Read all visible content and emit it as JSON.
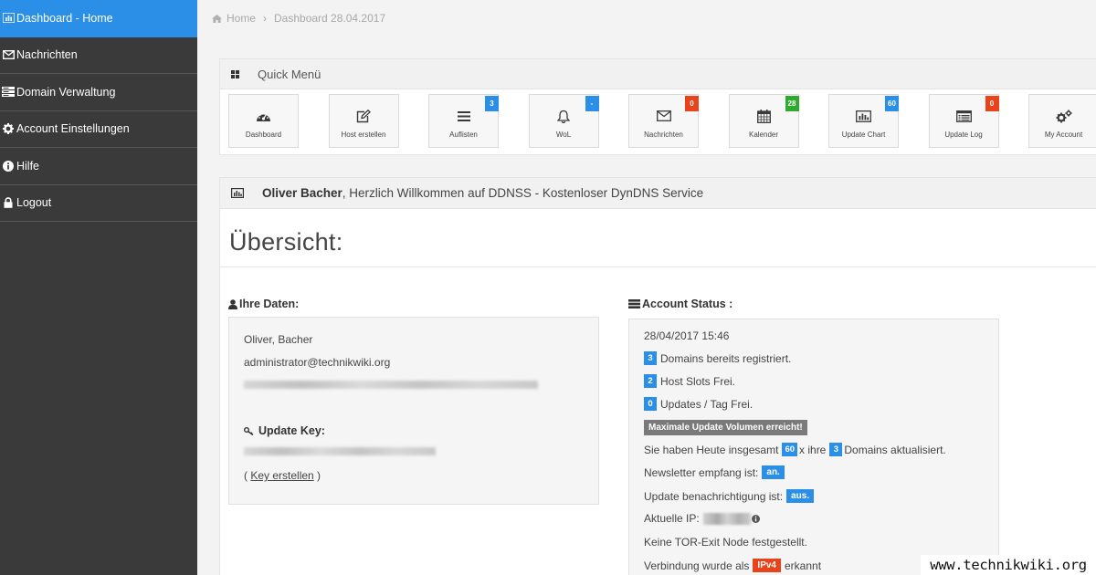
{
  "sidebar": {
    "items": [
      {
        "label": "Dashboard - Home",
        "icon": "bar-chart-icon",
        "active": true
      },
      {
        "label": "Nachrichten",
        "icon": "envelope-icon"
      },
      {
        "label": "Domain Verwaltung",
        "icon": "server-icon"
      },
      {
        "label": "Account Einstellungen",
        "icon": "gear-icon"
      },
      {
        "label": "Hilfe",
        "icon": "info-circle-icon"
      },
      {
        "label": "Logout",
        "icon": "lock-icon"
      }
    ]
  },
  "breadcrumb": {
    "home": "Home",
    "separator": "›",
    "current": "Dashboard 28.04.2017"
  },
  "quick_menu": {
    "title": "Quick Menü",
    "tiles": [
      {
        "label": "Dashboard",
        "icon": "tachometer-icon",
        "badge": null
      },
      {
        "label": "Host erstellen",
        "icon": "edit-icon",
        "badge": null
      },
      {
        "label": "Auflisten",
        "icon": "list-icon",
        "badge": "3",
        "badge_color": "#2b8fe8"
      },
      {
        "label": "WoL",
        "icon": "bell-icon",
        "badge": "-",
        "badge_color": "#2b8fe8"
      },
      {
        "label": "Nachrichten",
        "icon": "envelope-icon",
        "badge": "0",
        "badge_color": "#e8431a"
      },
      {
        "label": "Kalender",
        "icon": "calendar-icon",
        "badge": "28",
        "badge_color": "#2eaa2e"
      },
      {
        "label": "Update Chart",
        "icon": "bar-chart-icon",
        "badge": "60",
        "badge_color": "#2b8fe8"
      },
      {
        "label": "Update Log",
        "icon": "log-icon",
        "badge": "0",
        "badge_color": "#e8431a"
      },
      {
        "label": "My Account",
        "icon": "gears-icon",
        "badge": null
      }
    ]
  },
  "welcome": {
    "name": "Oliver Bacher",
    "text": ", Herzlich Willkommen auf DDNSS - Kostenloser DynDNS Service"
  },
  "overview": {
    "title": "Übersicht:"
  },
  "ihre_daten": {
    "heading": "Ihre Daten:",
    "name": "Oliver, Bacher",
    "email": "administrator@technikwiki.org",
    "update_key_label": "Update Key:",
    "key_link_open": "( ",
    "key_link": "Key erstellen",
    "key_link_close": " )"
  },
  "account_status": {
    "heading": "Account Status :",
    "datetime": "28/04/2017 15:46",
    "domains_count": "3",
    "domains_text": "Domains bereits registriert.",
    "host_slots_count": "2",
    "host_slots_text": "Host Slots Frei.",
    "updates_count": "0",
    "updates_text": "Updates / Tag Frei.",
    "warning": "Maximale Update Volumen erreicht!",
    "today_prefix": "Sie haben Heute insgesamt",
    "today_count": "60",
    "today_mid": "x ihre",
    "today_domains": "3",
    "today_suffix": "Domains aktualisiert.",
    "newsletter_text": "Newsletter empfang ist:",
    "newsletter_value": "an.",
    "update_notify_text": "Update benachrichtigung ist:",
    "update_notify_value": "aus.",
    "ip_label": "Aktuelle IP:",
    "tor_text": "Keine TOR-Exit Node festgestellt.",
    "connection_prefix": "Verbindung wurde als",
    "connection_value": "IPv4",
    "connection_suffix": "erkannt"
  },
  "watermark": "www.technikwiki.org",
  "colors": {
    "sidebar_bg": "#3a3a3a",
    "accent": "#2b8fe8",
    "danger": "#e8431a",
    "success": "#2eaa2e"
  }
}
